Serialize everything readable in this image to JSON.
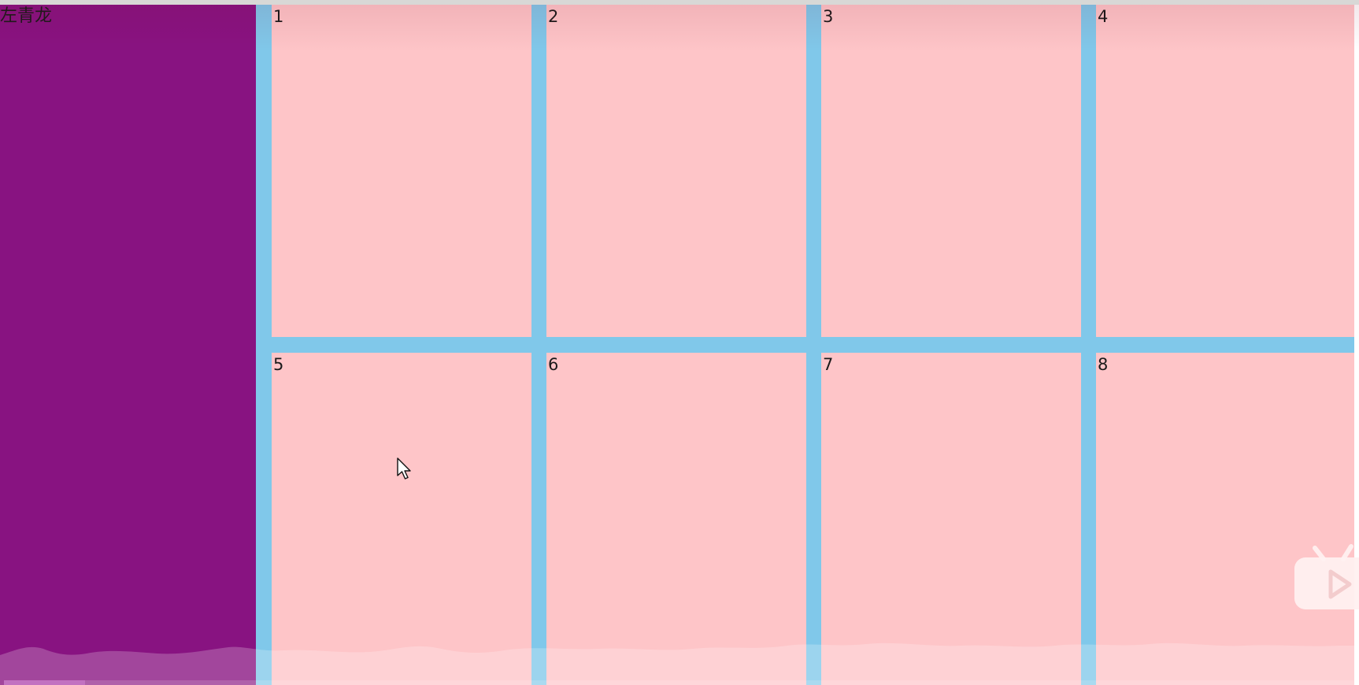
{
  "left_panel": {
    "label": "左青龙",
    "color": "#881381"
  },
  "grid": {
    "background_color": "#80c8ea",
    "cell_color": "#fec5c8",
    "cells": [
      {
        "label": "1"
      },
      {
        "label": "2"
      },
      {
        "label": "3"
      },
      {
        "label": "4"
      },
      {
        "label": "5"
      },
      {
        "label": "6"
      },
      {
        "label": "7"
      },
      {
        "label": "8"
      }
    ]
  },
  "player": {
    "progress_fraction": 0.06,
    "logo_icon": "bilibili-tv-play-icon",
    "cursor_icon": "mouse-pointer-icon"
  }
}
